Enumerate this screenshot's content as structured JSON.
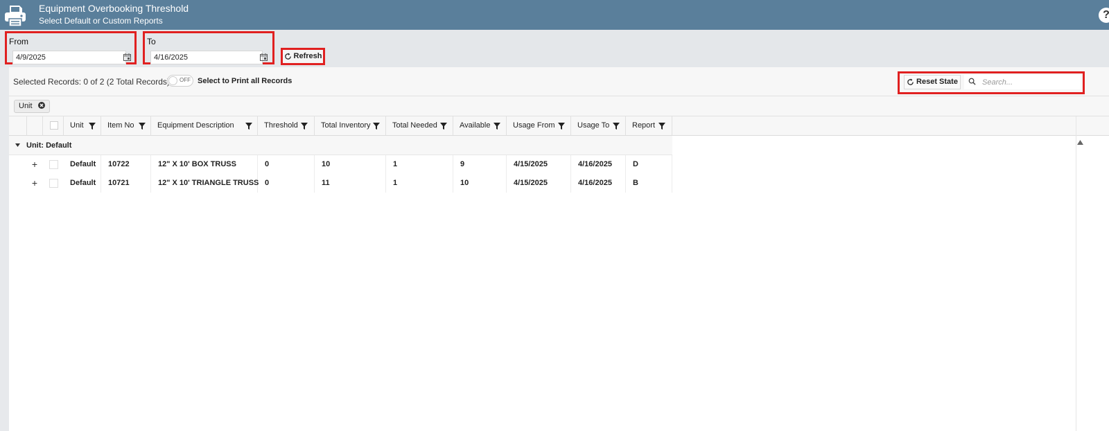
{
  "header": {
    "title": "Equipment Overbooking Threshold",
    "subtitle": "Select Default or Custom Reports",
    "help": "?"
  },
  "filters": {
    "from_label": "From",
    "from_value": "4/9/2025",
    "to_label": "To",
    "to_value": "4/16/2025",
    "refresh_label": "Refresh"
  },
  "toolbar": {
    "selected_records": "Selected Records: 0 of 2 (2 Total Records)",
    "toggle_state": "OFF",
    "print_all_label": "Select to Print all Records",
    "reset_state_label": "Reset State",
    "search_placeholder": "Search..."
  },
  "grouping": {
    "chip_label": "Unit"
  },
  "grid": {
    "columns": [
      "Unit",
      "Item No",
      "Equipment Description",
      "Threshold",
      "Total Inventory",
      "Total Needed",
      "Available",
      "Usage From",
      "Usage To",
      "Report"
    ],
    "group_label": "Unit: Default",
    "rows": [
      {
        "unit": "Default",
        "item_no": "10722",
        "description": "12\" X 10' BOX TRUSS",
        "threshold": "0",
        "total_inventory": "10",
        "total_needed": "1",
        "available": "9",
        "usage_from": "4/15/2025",
        "usage_to": "4/16/2025",
        "report": "D"
      },
      {
        "unit": "Default",
        "item_no": "10721",
        "description": "12\" X 10' TRIANGLE TRUSS",
        "threshold": "0",
        "total_inventory": "11",
        "total_needed": "1",
        "available": "10",
        "usage_from": "4/15/2025",
        "usage_to": "4/16/2025",
        "report": "B"
      }
    ]
  },
  "colors": {
    "header_bg": "#5a7f9b",
    "highlight_border": "#e02020",
    "filter_bg": "#e4e7ea"
  }
}
